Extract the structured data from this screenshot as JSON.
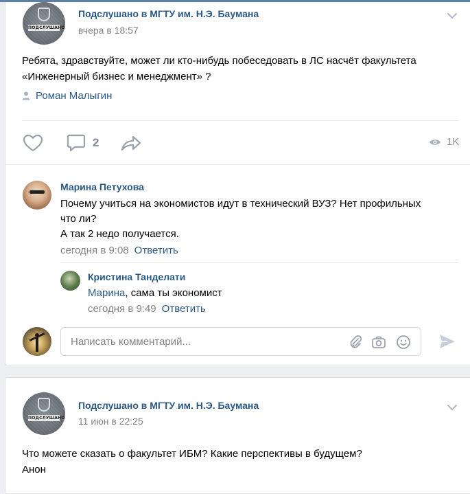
{
  "post1": {
    "group_name": "Подслушано в МГТУ им. Н.Э. Баумана",
    "time": "вчера в 18:57",
    "text_line1": "Ребята, здравствуйте, может ли кто-нибудь побеседовать в ЛС насчёт факультета",
    "text_line2": "«Инженерный бизнес и менеджмент» ?",
    "signer": "Роман Малыгин",
    "comments_count": "2",
    "views": "1K",
    "comments": [
      {
        "author": "Марина Петухова",
        "line1": "Почему учиться на экономистов идут в технический ВУЗ? Нет профильных",
        "line2": "что ли?",
        "line3": "А так 2 недо получается.",
        "time": "сегодня в 9:08",
        "reply": "Ответить"
      },
      {
        "author": "Кристина Танделати",
        "mention": "Марина",
        "text": ", сама ты экономист",
        "time": "сегодня в 9:49",
        "reply": "Ответить"
      }
    ],
    "comment_placeholder": "Написать комментарий..."
  },
  "post2": {
    "group_name": "Подслушано в МГТУ им. Н.Э. Баумана",
    "time": "11 июн в 22:25",
    "text_line1": "Что можете сказать о факультет ИБМ? Какие перспективы в будущем?",
    "text_line2": "Анон"
  },
  "avatar_banner": "ПОДСЛУШАНО",
  "colors": {
    "link": "#2a5885",
    "meta": "#828282",
    "icon": "#99a2ad",
    "background": "#edeef0"
  }
}
